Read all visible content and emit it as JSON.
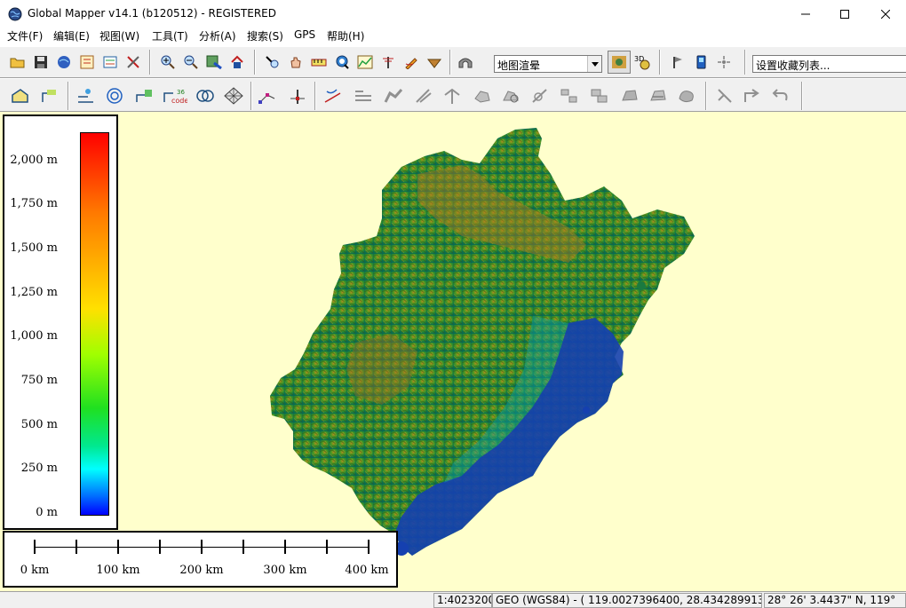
{
  "window": {
    "title": "Global Mapper v14.1 (b120512) - REGISTERED",
    "app_icon": "globe-icon"
  },
  "menu": {
    "items": [
      "文件(F)",
      "编辑(E)",
      "视图(W)",
      "工具(T)",
      "分析(A)",
      "搜索(S)",
      "GPS",
      "帮助(H)"
    ]
  },
  "toolbar1": {
    "shader_value": "地图渲晕",
    "favorites_placeholder": "设置收藏列表...",
    "icons": [
      "open-folder-icon",
      "save-icon",
      "globe-data-icon",
      "control-center-icon",
      "config-icon",
      "tools-icon",
      "zoom-in-icon",
      "zoom-out-icon",
      "zoom-extents-icon",
      "home-icon",
      "zoom-tool-icon",
      "pan-tool-icon",
      "measure-tool-icon",
      "feature-info-icon",
      "path-profile-icon",
      "viewshed-icon",
      "digitizer-icon",
      "vertical-shade-icon",
      "3d-view-icon",
      "shader-icon",
      "3d-icon",
      "flag-icon",
      "gps-device-icon",
      "gps-track-icon"
    ]
  },
  "toolbar2": {
    "icons": [
      "digitize-area-icon",
      "digitize-line-icon",
      "edit-line-icon",
      "contour-icon",
      "point-tool-icon",
      "code-icon",
      "circle-tool-icon",
      "grid-tool-icon",
      "move-vertex-icon",
      "insert-vertex-icon",
      "trace-icon",
      "split-icon",
      "merge-icon",
      "rotate-icon",
      "scale-icon",
      "combine-icon",
      "crop-icon",
      "buffer-icon",
      "intersect-icon",
      "union-icon",
      "difference-icon",
      "smooth-icon",
      "reshape-icon",
      "edit-shape-icon",
      "arrow-icon",
      "up-arrow-icon",
      "undo-icon"
    ]
  },
  "legend": {
    "ticks": [
      "2,000 m",
      "1,750 m",
      "1,500 m",
      "1,250 m",
      "1,000 m",
      "750 m",
      "500 m",
      "250 m",
      "0 m"
    ]
  },
  "scalebar": {
    "labels": [
      "0 km",
      "100 km",
      "200 km",
      "300 km",
      "400 km"
    ]
  },
  "status": {
    "scale": "1:4023200",
    "coordinates": "GEO (WGS84) - ( 119.0027396400, 28.4342899137 )",
    "dms": "28° 26' 3.4437\" N, 119°"
  },
  "colors": {
    "map_background": "#ffffcc",
    "land_low": "#0033aa",
    "land_mid": "#2a8a2a",
    "land_high": "#c07020"
  }
}
